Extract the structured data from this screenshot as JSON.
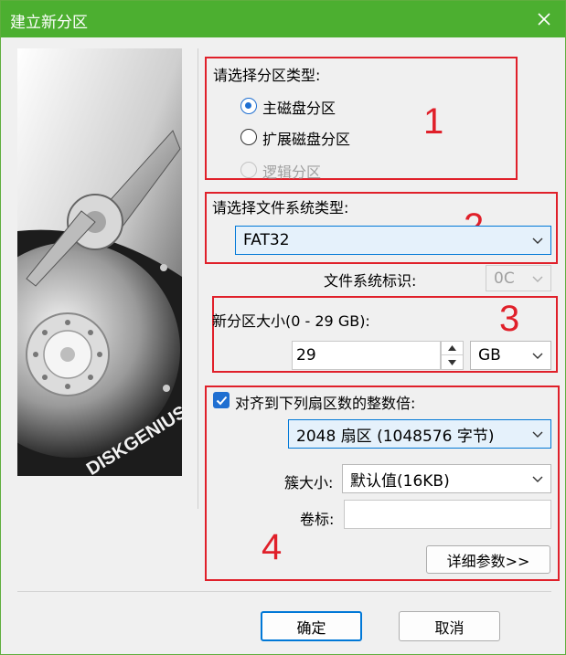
{
  "window": {
    "title": "建立新分区"
  },
  "partition_type": {
    "label": "请选择分区类型:",
    "options": [
      {
        "label": "主磁盘分区",
        "selected": true,
        "enabled": true
      },
      {
        "label": "扩展磁盘分区",
        "selected": false,
        "enabled": true
      },
      {
        "label": "逻辑分区",
        "selected": false,
        "enabled": false
      }
    ]
  },
  "filesystem": {
    "label": "请选择文件系统类型:",
    "value": "FAT32",
    "id_label": "文件系统标识:",
    "id_value": "0C"
  },
  "size": {
    "label": "新分区大小(0 - 29 GB):",
    "value": "29",
    "unit": "GB"
  },
  "alignment": {
    "checkbox_label": "对齐到下列扇区数的整数倍:",
    "checked": true,
    "sectors_value": "2048 扇区 (1048576 字节)"
  },
  "cluster": {
    "label": "簇大小:",
    "value": "默认值(16KB)"
  },
  "volume": {
    "label": "卷标:",
    "value": ""
  },
  "buttons": {
    "advanced": "详细参数>>",
    "ok": "确定",
    "cancel": "取消"
  },
  "image": {
    "brand_text": "DISKGENIUS"
  },
  "annotations": [
    "1",
    "2",
    "3",
    "4"
  ],
  "colors": {
    "titlebar": "#4caf30",
    "accent": "#1f6fd1",
    "annotation": "#e0202a"
  }
}
